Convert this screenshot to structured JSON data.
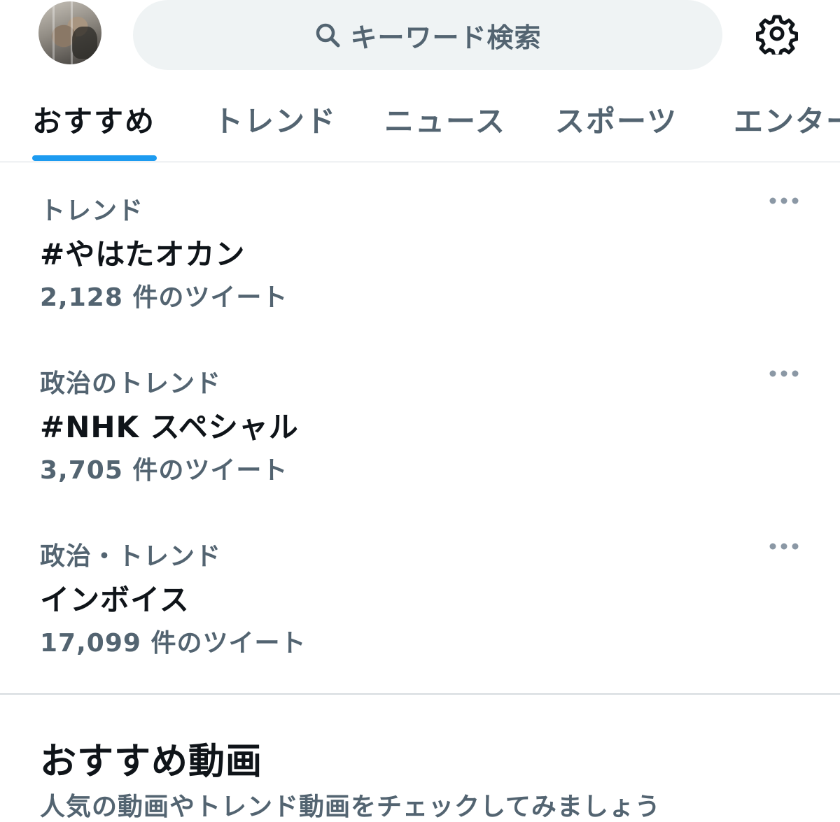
{
  "header": {
    "search_placeholder": "キーワード検索"
  },
  "tabs": [
    {
      "label": "おすすめ",
      "active": true
    },
    {
      "label": "トレンド",
      "active": false
    },
    {
      "label": "ニュース",
      "active": false
    },
    {
      "label": "スポーツ",
      "active": false
    },
    {
      "label": "エンターテイメント",
      "active": false
    }
  ],
  "trends": [
    {
      "context": "トレンド",
      "name": "#やはたオカン",
      "count": "2,128 件のツイート"
    },
    {
      "context": "政治のトレンド",
      "name": "#NHK スペシャル",
      "count": "3,705 件のツイート"
    },
    {
      "context": "政治・トレンド",
      "name": "インボイス",
      "count": "17,099 件のツイート"
    }
  ],
  "recommended_videos": {
    "title": "おすすめ動画",
    "subtitle": "人気の動画やトレンド動画をチェックしてみましょう"
  },
  "colors": {
    "accent": "#1d9bf0",
    "secondary_text": "#536471",
    "primary_text": "#0f1419",
    "search_bg": "#eff3f4"
  },
  "icons": {
    "search": "search-icon",
    "settings": "gear-icon",
    "more": "more-dots-icon"
  }
}
